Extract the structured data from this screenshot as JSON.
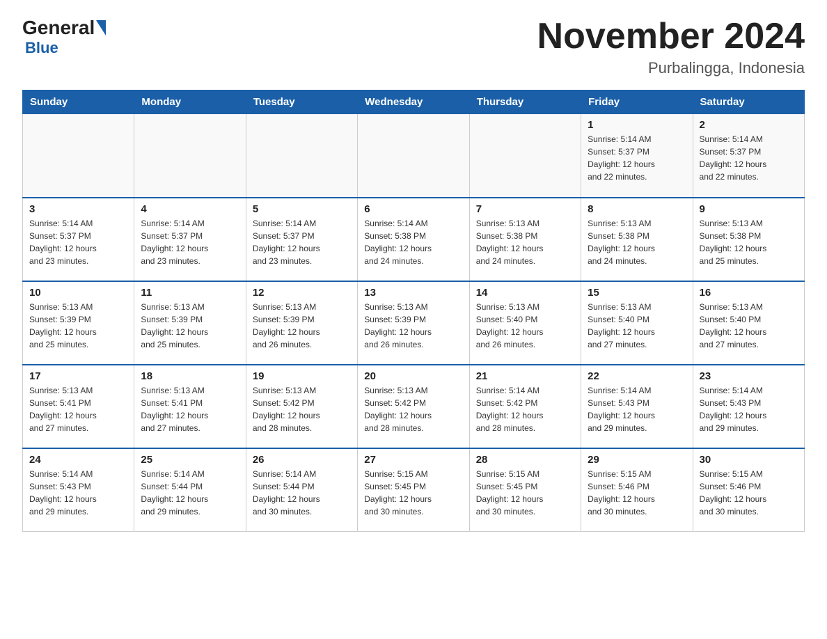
{
  "logo": {
    "general": "General",
    "blue": "Blue"
  },
  "title": "November 2024",
  "subtitle": "Purbalingga, Indonesia",
  "days_of_week": [
    "Sunday",
    "Monday",
    "Tuesday",
    "Wednesday",
    "Thursday",
    "Friday",
    "Saturday"
  ],
  "weeks": [
    [
      {
        "num": "",
        "info": ""
      },
      {
        "num": "",
        "info": ""
      },
      {
        "num": "",
        "info": ""
      },
      {
        "num": "",
        "info": ""
      },
      {
        "num": "",
        "info": ""
      },
      {
        "num": "1",
        "info": "Sunrise: 5:14 AM\nSunset: 5:37 PM\nDaylight: 12 hours\nand 22 minutes."
      },
      {
        "num": "2",
        "info": "Sunrise: 5:14 AM\nSunset: 5:37 PM\nDaylight: 12 hours\nand 22 minutes."
      }
    ],
    [
      {
        "num": "3",
        "info": "Sunrise: 5:14 AM\nSunset: 5:37 PM\nDaylight: 12 hours\nand 23 minutes."
      },
      {
        "num": "4",
        "info": "Sunrise: 5:14 AM\nSunset: 5:37 PM\nDaylight: 12 hours\nand 23 minutes."
      },
      {
        "num": "5",
        "info": "Sunrise: 5:14 AM\nSunset: 5:37 PM\nDaylight: 12 hours\nand 23 minutes."
      },
      {
        "num": "6",
        "info": "Sunrise: 5:14 AM\nSunset: 5:38 PM\nDaylight: 12 hours\nand 24 minutes."
      },
      {
        "num": "7",
        "info": "Sunrise: 5:13 AM\nSunset: 5:38 PM\nDaylight: 12 hours\nand 24 minutes."
      },
      {
        "num": "8",
        "info": "Sunrise: 5:13 AM\nSunset: 5:38 PM\nDaylight: 12 hours\nand 24 minutes."
      },
      {
        "num": "9",
        "info": "Sunrise: 5:13 AM\nSunset: 5:38 PM\nDaylight: 12 hours\nand 25 minutes."
      }
    ],
    [
      {
        "num": "10",
        "info": "Sunrise: 5:13 AM\nSunset: 5:39 PM\nDaylight: 12 hours\nand 25 minutes."
      },
      {
        "num": "11",
        "info": "Sunrise: 5:13 AM\nSunset: 5:39 PM\nDaylight: 12 hours\nand 25 minutes."
      },
      {
        "num": "12",
        "info": "Sunrise: 5:13 AM\nSunset: 5:39 PM\nDaylight: 12 hours\nand 26 minutes."
      },
      {
        "num": "13",
        "info": "Sunrise: 5:13 AM\nSunset: 5:39 PM\nDaylight: 12 hours\nand 26 minutes."
      },
      {
        "num": "14",
        "info": "Sunrise: 5:13 AM\nSunset: 5:40 PM\nDaylight: 12 hours\nand 26 minutes."
      },
      {
        "num": "15",
        "info": "Sunrise: 5:13 AM\nSunset: 5:40 PM\nDaylight: 12 hours\nand 27 minutes."
      },
      {
        "num": "16",
        "info": "Sunrise: 5:13 AM\nSunset: 5:40 PM\nDaylight: 12 hours\nand 27 minutes."
      }
    ],
    [
      {
        "num": "17",
        "info": "Sunrise: 5:13 AM\nSunset: 5:41 PM\nDaylight: 12 hours\nand 27 minutes."
      },
      {
        "num": "18",
        "info": "Sunrise: 5:13 AM\nSunset: 5:41 PM\nDaylight: 12 hours\nand 27 minutes."
      },
      {
        "num": "19",
        "info": "Sunrise: 5:13 AM\nSunset: 5:42 PM\nDaylight: 12 hours\nand 28 minutes."
      },
      {
        "num": "20",
        "info": "Sunrise: 5:13 AM\nSunset: 5:42 PM\nDaylight: 12 hours\nand 28 minutes."
      },
      {
        "num": "21",
        "info": "Sunrise: 5:14 AM\nSunset: 5:42 PM\nDaylight: 12 hours\nand 28 minutes."
      },
      {
        "num": "22",
        "info": "Sunrise: 5:14 AM\nSunset: 5:43 PM\nDaylight: 12 hours\nand 29 minutes."
      },
      {
        "num": "23",
        "info": "Sunrise: 5:14 AM\nSunset: 5:43 PM\nDaylight: 12 hours\nand 29 minutes."
      }
    ],
    [
      {
        "num": "24",
        "info": "Sunrise: 5:14 AM\nSunset: 5:43 PM\nDaylight: 12 hours\nand 29 minutes."
      },
      {
        "num": "25",
        "info": "Sunrise: 5:14 AM\nSunset: 5:44 PM\nDaylight: 12 hours\nand 29 minutes."
      },
      {
        "num": "26",
        "info": "Sunrise: 5:14 AM\nSunset: 5:44 PM\nDaylight: 12 hours\nand 30 minutes."
      },
      {
        "num": "27",
        "info": "Sunrise: 5:15 AM\nSunset: 5:45 PM\nDaylight: 12 hours\nand 30 minutes."
      },
      {
        "num": "28",
        "info": "Sunrise: 5:15 AM\nSunset: 5:45 PM\nDaylight: 12 hours\nand 30 minutes."
      },
      {
        "num": "29",
        "info": "Sunrise: 5:15 AM\nSunset: 5:46 PM\nDaylight: 12 hours\nand 30 minutes."
      },
      {
        "num": "30",
        "info": "Sunrise: 5:15 AM\nSunset: 5:46 PM\nDaylight: 12 hours\nand 30 minutes."
      }
    ]
  ]
}
